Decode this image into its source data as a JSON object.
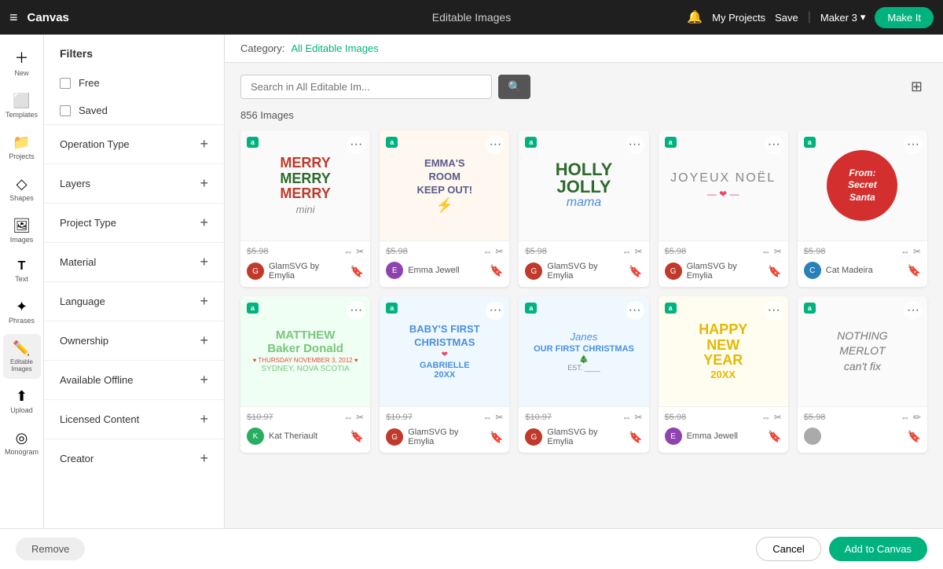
{
  "topbar": {
    "menu_icon": "≡",
    "title": "Canvas",
    "center": "Editable Images",
    "bell_icon": "🔔",
    "my_projects": "My Projects",
    "save": "Save",
    "divider": "|",
    "maker": "Maker 3",
    "chevron": "▾",
    "cta": "Make It"
  },
  "left_nav": {
    "items": [
      {
        "icon": "＋",
        "label": "New"
      },
      {
        "icon": "⬜",
        "label": "Templates"
      },
      {
        "icon": "📁",
        "label": "Projects"
      },
      {
        "icon": "◇",
        "label": "Shapes"
      },
      {
        "icon": "🖼",
        "label": "Images"
      },
      {
        "icon": "T",
        "label": "Text"
      },
      {
        "icon": "✦",
        "label": "Phrases"
      },
      {
        "icon": "✏️",
        "label": "Editable Images"
      },
      {
        "icon": "⬆",
        "label": "Upload"
      },
      {
        "icon": "◎",
        "label": "Monogram"
      }
    ]
  },
  "sidebar": {
    "title": "Filters",
    "free_label": "Free",
    "saved_label": "Saved",
    "filters": [
      {
        "label": "Operation Type"
      },
      {
        "label": "Layers"
      },
      {
        "label": "Project Type"
      },
      {
        "label": "Material"
      },
      {
        "label": "Language"
      },
      {
        "label": "Ownership"
      },
      {
        "label": "Available Offline"
      },
      {
        "label": "Licensed Content"
      },
      {
        "label": "Creator"
      }
    ]
  },
  "content": {
    "category_label": "Category:",
    "category_value": "All Editable Images",
    "search_placeholder": "Search in All Editable Im...",
    "image_count": "856 Images",
    "images": [
      {
        "badge": "a",
        "price": "$5.98",
        "author": "GlamSVG by Emylia",
        "author_color": "#c0392b",
        "title": "Merry Merry Merry Mini",
        "type": "merry"
      },
      {
        "badge": "a",
        "price": "$5.98",
        "author": "Emma Jewell",
        "author_color": "#8e44ad",
        "title": "Emma's Room Keep Out",
        "type": "emma"
      },
      {
        "badge": "a",
        "price": "$5.98",
        "author": "GlamSVG by Emylia",
        "author_color": "#c0392b",
        "title": "Holly Jolly Mama",
        "type": "holly"
      },
      {
        "badge": "a",
        "price": "$5.98",
        "author": "GlamSVG by Emylia",
        "author_color": "#c0392b",
        "title": "Joyeux Noël",
        "type": "joyeux"
      },
      {
        "badge": "a",
        "price": "$5.98",
        "author": "Cat Madeira",
        "author_color": "#2980b9",
        "title": "From Secret Santa",
        "type": "secret"
      },
      {
        "badge": "a",
        "price": "$10.97",
        "author": "Kat Theriault",
        "author_color": "#27ae60",
        "title": "Matthew Baker Donald",
        "type": "matthew"
      },
      {
        "badge": "a",
        "price": "$10.97",
        "author": "GlamSVG by Emylia",
        "author_color": "#c0392b",
        "title": "Baby's First Christmas Gabrielle 20XX",
        "type": "baby"
      },
      {
        "badge": "a",
        "price": "$10.97",
        "author": "GlamSVG by Emylia",
        "author_color": "#c0392b",
        "title": "Janes Our First Christmas",
        "type": "sarah"
      },
      {
        "badge": "a",
        "price": "$5.98",
        "author": "Emma Jewell",
        "author_color": "#8e44ad",
        "title": "Happy New Year 20XX",
        "type": "newyear"
      },
      {
        "badge": "a",
        "price": "$5.98",
        "author": "",
        "author_color": "#888",
        "title": "Nothing Merlot Can't Fix",
        "type": "merlot"
      }
    ]
  },
  "bottom_bar": {
    "remove": "Remove",
    "cancel": "Cancel",
    "add_to_canvas": "Add to Canvas"
  }
}
